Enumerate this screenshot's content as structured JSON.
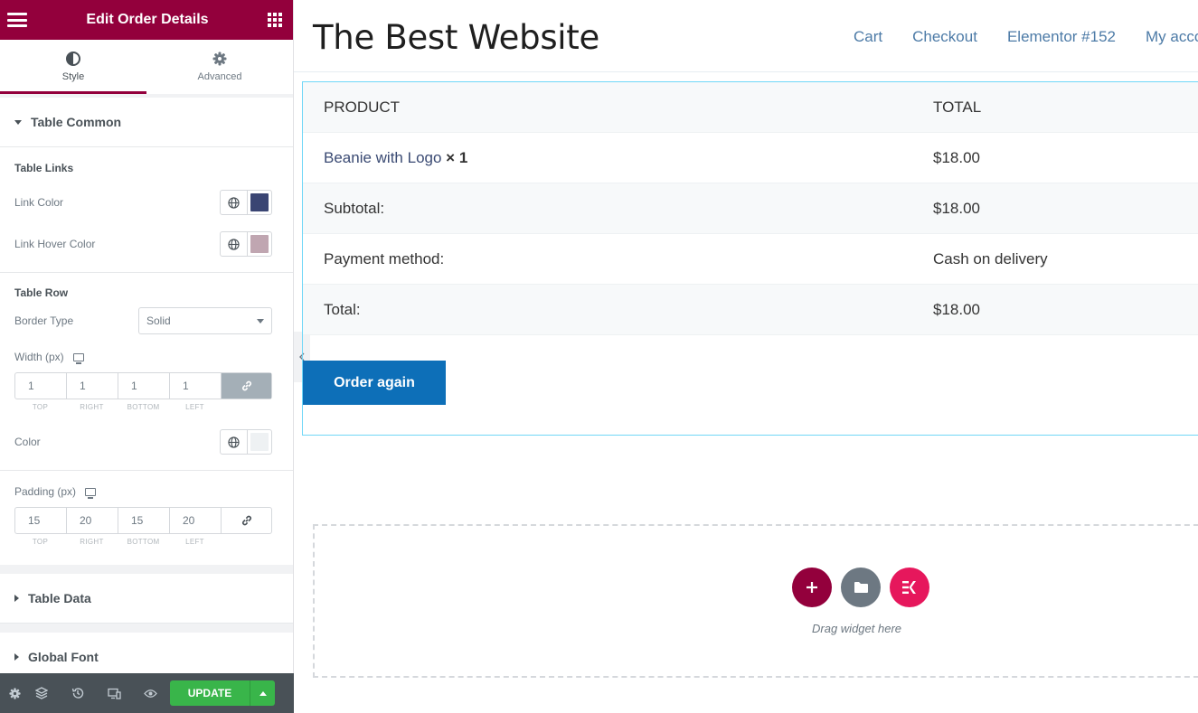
{
  "panel": {
    "title": "Edit Order Details",
    "tabs": [
      {
        "label": "Style",
        "icon": "half-circle-icon",
        "active": true
      },
      {
        "label": "Advanced",
        "icon": "gear-icon",
        "active": false
      }
    ],
    "sections": {
      "table_common": "Table Common",
      "table_data": "Table Data",
      "global_font": "Global Font"
    },
    "table_links": {
      "heading": "Table Links",
      "link_color_label": "Link Color",
      "link_color": "#3a4573",
      "link_hover_label": "Link Hover Color",
      "link_hover_color": "#c0a6b1"
    },
    "table_row": {
      "heading": "Table Row",
      "border_type_label": "Border Type",
      "border_type_value": "Solid",
      "width_label": "Width (px)",
      "width": {
        "top": "1",
        "right": "1",
        "bottom": "1",
        "left": "1"
      },
      "color_label": "Color",
      "color_value": "#eef1f3",
      "padding_label": "Padding (px)",
      "padding": {
        "top": "15",
        "right": "20",
        "bottom": "15",
        "left": "20"
      }
    },
    "dim_caps": {
      "top": "TOP",
      "right": "RIGHT",
      "bottom": "BOTTOM",
      "left": "LEFT"
    },
    "footer": {
      "update_label": "UPDATE"
    }
  },
  "site": {
    "title": "The Best Website",
    "nav": [
      "Cart",
      "Checkout",
      "Elementor #152",
      "My account"
    ]
  },
  "order": {
    "headers": {
      "product": "PRODUCT",
      "total": "TOTAL"
    },
    "item": {
      "name": "Beanie with Logo",
      "qty": "× 1",
      "total": "$18.00"
    },
    "subtotal": {
      "label": "Subtotal:",
      "value": "$18.00"
    },
    "payment": {
      "label": "Payment method:",
      "value": "Cash on delivery"
    },
    "total": {
      "label": "Total:",
      "value": "$18.00"
    },
    "order_again": "Order again"
  },
  "drop_zone": {
    "text": "Drag widget here"
  },
  "colors": {
    "brand": "#93003c",
    "update": "#39b54a",
    "button": "#0d6fb8",
    "kit": "#e6175c"
  }
}
